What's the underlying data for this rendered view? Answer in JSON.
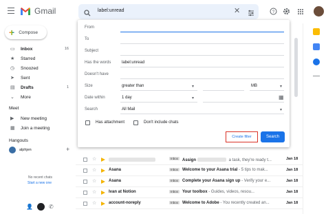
{
  "app": {
    "name": "Gmail"
  },
  "search": {
    "value": "label:unread"
  },
  "compose": {
    "label": "Compose"
  },
  "nav": [
    {
      "icon": "inbox-icon",
      "glyph": "▭",
      "label": "Inbox",
      "count": "16",
      "bold": true
    },
    {
      "icon": "star-icon",
      "glyph": "★",
      "label": "Starred",
      "count": "",
      "bold": false
    },
    {
      "icon": "clock-icon",
      "glyph": "◷",
      "label": "Snoozed",
      "count": "",
      "bold": false
    },
    {
      "icon": "send-icon",
      "glyph": "➤",
      "label": "Sent",
      "count": "",
      "bold": false
    },
    {
      "icon": "draft-icon",
      "glyph": "▤",
      "label": "Drafts",
      "count": "1",
      "bold": true
    },
    {
      "icon": "chevron-down-icon",
      "glyph": "⌄",
      "label": "More",
      "count": "",
      "bold": false
    }
  ],
  "meet": {
    "title": "Meet",
    "new_meeting": "New meeting",
    "join_meeting": "Join a meeting"
  },
  "hangouts": {
    "title": "Hangouts",
    "user": "alphjen",
    "no_chats": "No recent chats",
    "start_new": "Start a new one"
  },
  "filter": {
    "from_label": "From",
    "to_label": "To",
    "subject_label": "Subject",
    "has_words_label": "Has the words",
    "has_words_value": "label:unread",
    "doesnt_have_label": "Doesn't have",
    "size_label": "Size",
    "size_op": "greater than",
    "size_unit": "MB",
    "date_label": "Date within",
    "date_value": "1 day",
    "search_label": "Search",
    "search_value": "All Mail",
    "has_attachment": "Has attachment",
    "no_chats": "Don't include chats",
    "create_filter": "Create filter",
    "search_button": "Search"
  },
  "emails": [
    {
      "sender": "",
      "tag": "Inbox",
      "subject": "Assign",
      "snippet": " a task, they're ready t...",
      "date": "Jan 18"
    },
    {
      "sender": "Asana",
      "tag": "Inbox",
      "subject": "Welcome to your Asana trial",
      "snippet": " - 5 tips to mak...",
      "date": "Jan 18"
    },
    {
      "sender": "Asana",
      "tag": "Inbox",
      "subject": "Complete your Asana sign up",
      "snippet": " - Verify your e...",
      "date": "Jan 18"
    },
    {
      "sender": "Ivan at Notion",
      "tag": "Inbox",
      "subject": "Your toolbox",
      "snippet": " - Guides, videos, resou...",
      "date": "Jan 18"
    },
    {
      "sender": "account-noreply",
      "tag": "Inbox",
      "subject": "Welcome to Adobe",
      "snippet": " - You recently created an...",
      "date": "Jan 18"
    }
  ],
  "colors": {
    "accent": "#1a73e8",
    "highlight": "#d93025",
    "search_bg": "#eaf1fb"
  }
}
